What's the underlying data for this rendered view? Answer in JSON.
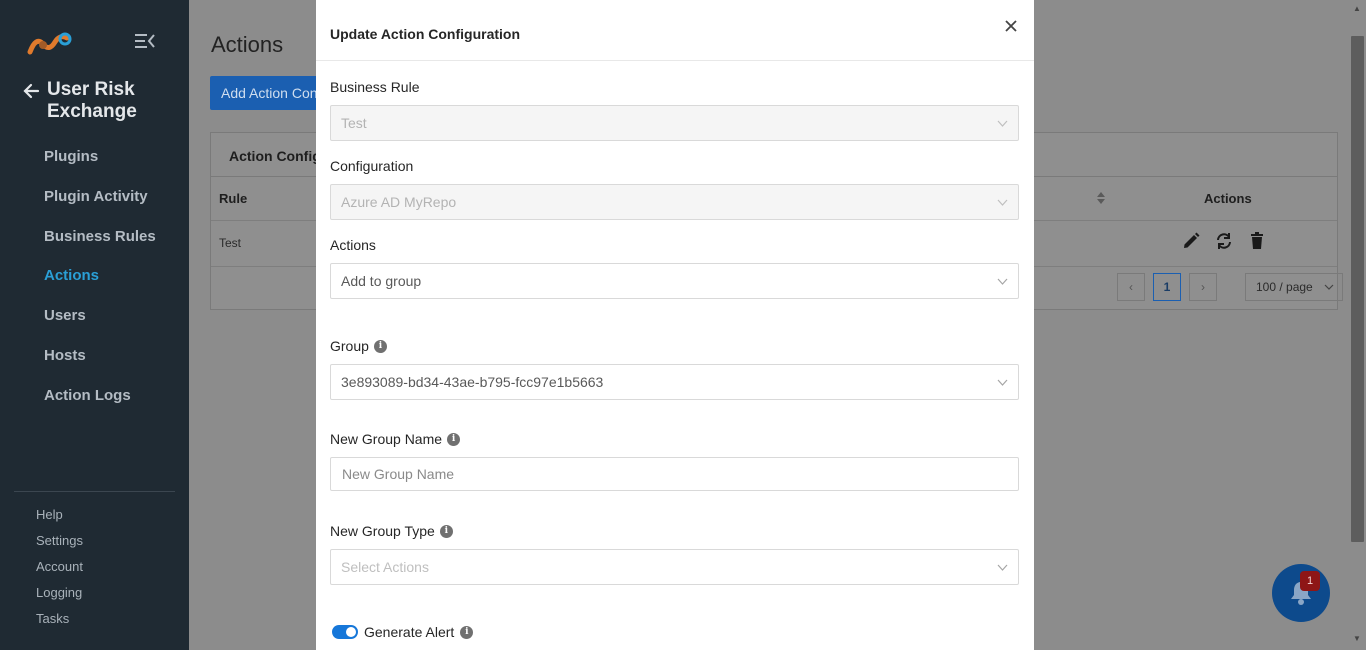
{
  "sidebar": {
    "back_label": "User Risk Exchange",
    "nav": [
      "Plugins",
      "Plugin Activity",
      "Business Rules",
      "Actions",
      "Users",
      "Hosts",
      "Action Logs"
    ],
    "active_nav": "Actions",
    "sub_nav": [
      "Help",
      "Settings",
      "Account",
      "Logging",
      "Tasks"
    ]
  },
  "page": {
    "title": "Actions",
    "add_button": "Add Action Configuration",
    "card_title": "Action Configurations",
    "table_headers": {
      "rule": "Rule",
      "actions": "Actions"
    },
    "rows": [
      {
        "rule": "Test"
      }
    ],
    "pagination": {
      "current_page": "1",
      "page_size": "100 / page"
    }
  },
  "notifications": {
    "count": "1"
  },
  "modal": {
    "title": "Update Action Configuration",
    "business_rule": {
      "label": "Business Rule",
      "value": "Test"
    },
    "configuration": {
      "label": "Configuration",
      "value": "Azure AD MyRepo"
    },
    "actions": {
      "label": "Actions",
      "value": "Add to group"
    },
    "group": {
      "label": "Group",
      "value": "3e893089-bd34-43ae-b795-fcc97e1b5663"
    },
    "new_group_name": {
      "label": "New Group Name",
      "placeholder": "New Group Name"
    },
    "new_group_type": {
      "label": "New Group Type",
      "placeholder": "Select Actions"
    },
    "generate_alert": {
      "label": "Generate Alert",
      "enabled": true
    }
  },
  "colors": {
    "accent": "#1677d9",
    "sidebar_bg": "#1f2a33",
    "active_nav": "#2a9fd6"
  }
}
